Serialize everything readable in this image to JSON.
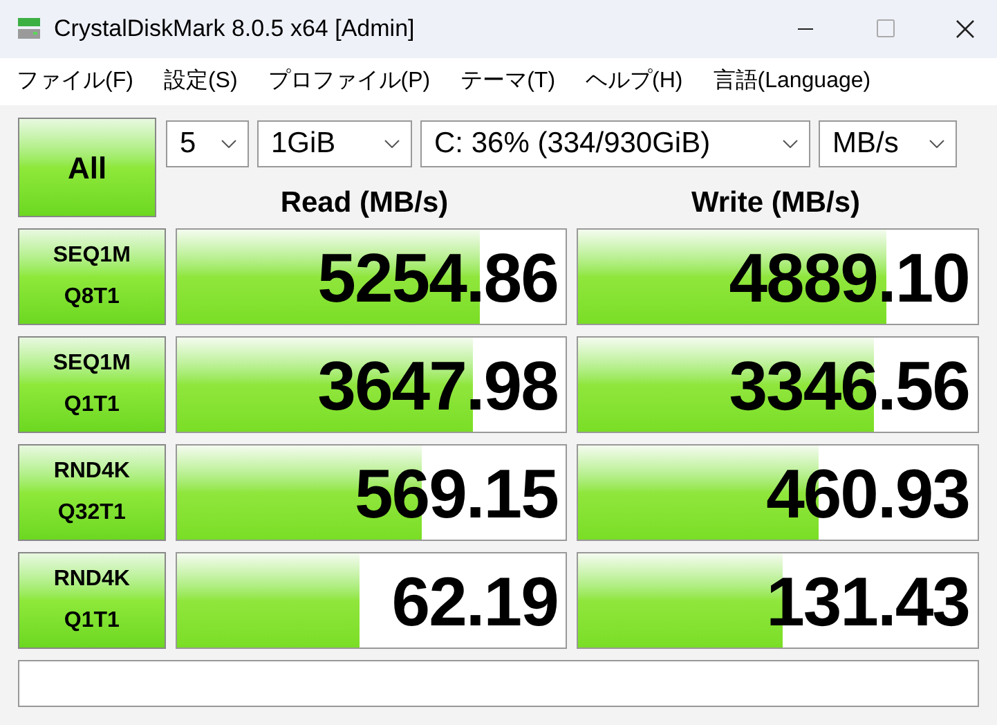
{
  "window": {
    "title": "CrystalDiskMark 8.0.5 x64 [Admin]"
  },
  "menu": [
    "ファイル(F)",
    "設定(S)",
    "プロファイル(P)",
    "テーマ(T)",
    "ヘルプ(H)",
    "言語(Language)"
  ],
  "all_button": "All",
  "selectors": [
    {
      "value": "5"
    },
    {
      "value": "1GiB"
    },
    {
      "value": "C: 36% (334/930GiB)"
    },
    {
      "value": "MB/s"
    }
  ],
  "columns": [
    "Read (MB/s)",
    "Write (MB/s)"
  ],
  "tests": [
    {
      "label": [
        "SEQ1M",
        "Q8T1"
      ],
      "read": {
        "value": "5254.86",
        "level": 0.78
      },
      "write": {
        "value": "4889.10",
        "level": 0.77
      }
    },
    {
      "label": [
        "SEQ1M",
        "Q1T1"
      ],
      "read": {
        "value": "3647.98",
        "level": 0.76
      },
      "write": {
        "value": "3346.56",
        "level": 0.74
      }
    },
    {
      "label": [
        "RND4K",
        "Q32T1"
      ],
      "read": {
        "value": "569.15",
        "level": 0.63
      },
      "write": {
        "value": "460.93",
        "level": 0.6
      }
    },
    {
      "label": [
        "RND4K",
        "Q1T1"
      ],
      "read": {
        "value": "62.19",
        "level": 0.47
      },
      "write": {
        "value": "131.43",
        "level": 0.51
      }
    }
  ]
}
